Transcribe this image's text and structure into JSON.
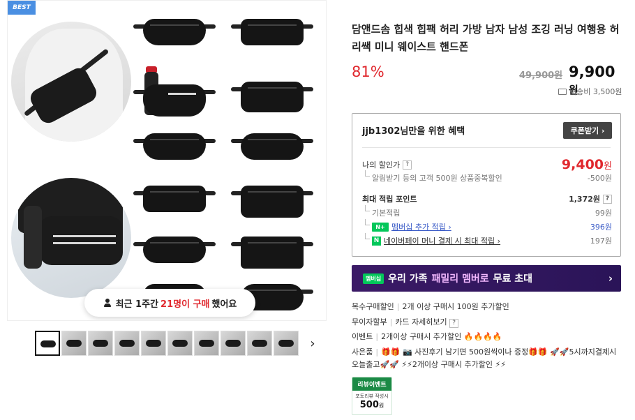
{
  "badge": "BEST",
  "purchase_notice": {
    "prefix": "최근 1주간",
    "highlight": "21명이 구매",
    "suffix": "했어요"
  },
  "product": {
    "title": "담앤드솜 힙색 힙팩 허리 가방 남자 남성 조깅 러닝 여행용 허리쌕 미니 웨이스트 핸드폰",
    "discount": "81%",
    "original_price": "49,900원",
    "sale_price": "9,900",
    "sale_unit": "원",
    "shipping": "배송비 3,500원"
  },
  "benefit": {
    "header": "jjb1302님만을 위한 혜택",
    "coupon_button": "쿠폰받기 ›",
    "my_discount_label": "나의 할인가",
    "my_discount_value": "9,400",
    "my_discount_unit": "원",
    "alert_label": "알림받기 등의 고객 500원 상품중복할인",
    "alert_value": "-500원",
    "max_point_label": "최대 적립 포인트",
    "max_point_value": "1,372원",
    "base_label": "기본적립",
    "base_value": "99원",
    "membership_label": "멤버십 추가 적립 ›",
    "membership_value": "396원",
    "npay_label": "네이버페이 머니 결제 시 최대 적립 ›",
    "npay_value": "197원"
  },
  "family_banner": {
    "badge": "멤버십",
    "text_pre": "우리 가족",
    "text_hl": "패밀리 멤버로",
    "text_post": "무료 초대"
  },
  "promos": [
    {
      "key": "복수구매할인",
      "value": "2개 이상 구매시 100원 추가할인"
    },
    {
      "key": "무이자할부",
      "value": "카드 자세히보기"
    },
    {
      "key": "이벤트",
      "value": "2개이상 구매시 추가할인 🔥🔥🔥🔥"
    },
    {
      "key": "사은품",
      "value": "🎁🎁 📷 사진후기 남기면 500원씩이나 증정🎁🎁 🚀🚀5시까지결제시 오늘출고🚀🚀 ⚡⚡2개이상 구매시 추가할인 ⚡⚡"
    }
  ],
  "review_event": {
    "title": "리뷰이벤트",
    "desc": "포토리뷰 작성시",
    "amount": "500",
    "unit": "원"
  },
  "colors": {
    "accent_red": "#e0282e",
    "naver_green": "#03c75a",
    "banner_purple": "#3b1a66",
    "best_blue": "#4a8fe2"
  },
  "icons": [
    "person-icon",
    "truck-icon",
    "question-icon",
    "chevron-right-icon",
    "naver-plus-icon",
    "npay-icon"
  ]
}
